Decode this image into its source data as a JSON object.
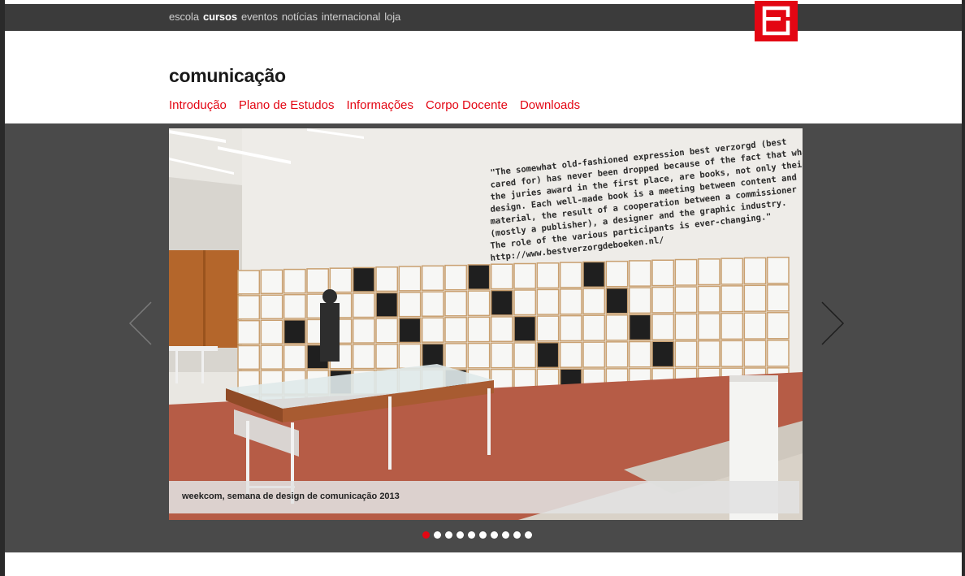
{
  "topnav": {
    "items": [
      {
        "label": "escola",
        "active": false
      },
      {
        "label": "cursos",
        "active": true
      },
      {
        "label": "eventos",
        "active": false
      },
      {
        "label": "notícias",
        "active": false
      },
      {
        "label": "internacional",
        "active": false
      },
      {
        "label": "loja",
        "active": false
      }
    ]
  },
  "page": {
    "title": "comunicação",
    "subnav": [
      "Introdução",
      "Plano de Estudos",
      "Informações",
      "Corpo Docente",
      "Downloads"
    ]
  },
  "slider": {
    "caption": "weekcom, semana de design de comunicação 2013",
    "wall_text": [
      "\"The somewhat old-fashioned expression best verzorgd (best",
      "cared for) has never been dropped because of the fact that what",
      "the juries award in the first place, are books, not only their",
      "design. Each well-made book is a meeting between content and",
      "material, the result of a cooperation between a commissioner",
      "(mostly a publisher), a designer and the graphic industry.",
      "The role of the various participants is ever-changing.\"",
      "http://www.bestverzorgdeboeken.nl/"
    ],
    "dot_count": 10,
    "active_index": 0
  },
  "colors": {
    "brand_red": "#e30613",
    "topbar": "#3b3b3b",
    "stage": "#4a4a4a"
  },
  "icons": {
    "logo": "brand-logo-icon",
    "prev": "chevron-left-icon",
    "next": "chevron-right-icon"
  }
}
